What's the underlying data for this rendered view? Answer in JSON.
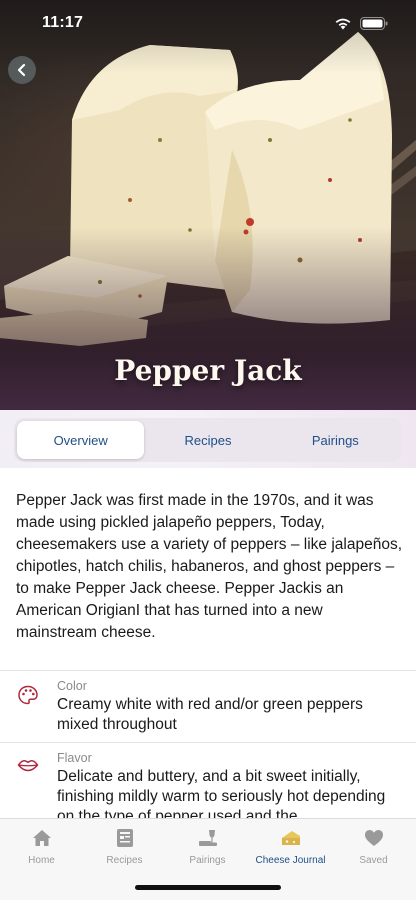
{
  "status_bar": {
    "time": "11:17"
  },
  "hero": {
    "title": "Pepper Jack"
  },
  "segments": [
    {
      "label": "Overview",
      "active": true
    },
    {
      "label": "Recipes",
      "active": false
    },
    {
      "label": "Pairings",
      "active": false
    }
  ],
  "description": "Pepper Jack was first made in the 1970s, and it was made using pickled jalapeño peppers, Today, cheesemakers use a variety of peppers – like jalapeños, chipotles, hatch chilis, habaneros, and ghost peppers – to make Pepper Jack cheese. Pepper Jackis an American OrigianI that has turned into a new mainstream cheese.",
  "attributes": [
    {
      "icon": "palette-icon",
      "label": "Color",
      "value": "Creamy white with red and/or green peppers mixed throughout"
    },
    {
      "icon": "lips-icon",
      "label": "Flavor",
      "value": "Delicate and buttery, and a bit sweet initially, finishing mildly warm to seriously hot depending on the type of pepper used and the"
    }
  ],
  "tabs": [
    {
      "icon": "home-icon",
      "label": "Home",
      "active": false
    },
    {
      "icon": "recipes-icon",
      "label": "Recipes",
      "active": false
    },
    {
      "icon": "pairings-icon",
      "label": "Pairings",
      "active": false
    },
    {
      "icon": "cheese-journal-icon",
      "label": "Cheese Journal",
      "active": true
    },
    {
      "icon": "heart-icon",
      "label": "Saved",
      "active": false
    }
  ],
  "colors": {
    "accent": "#1f4f86",
    "inactive_tab": "#9a9a9a",
    "icon_red": "#b0283c",
    "cheese_gold": "#d9b44a"
  }
}
